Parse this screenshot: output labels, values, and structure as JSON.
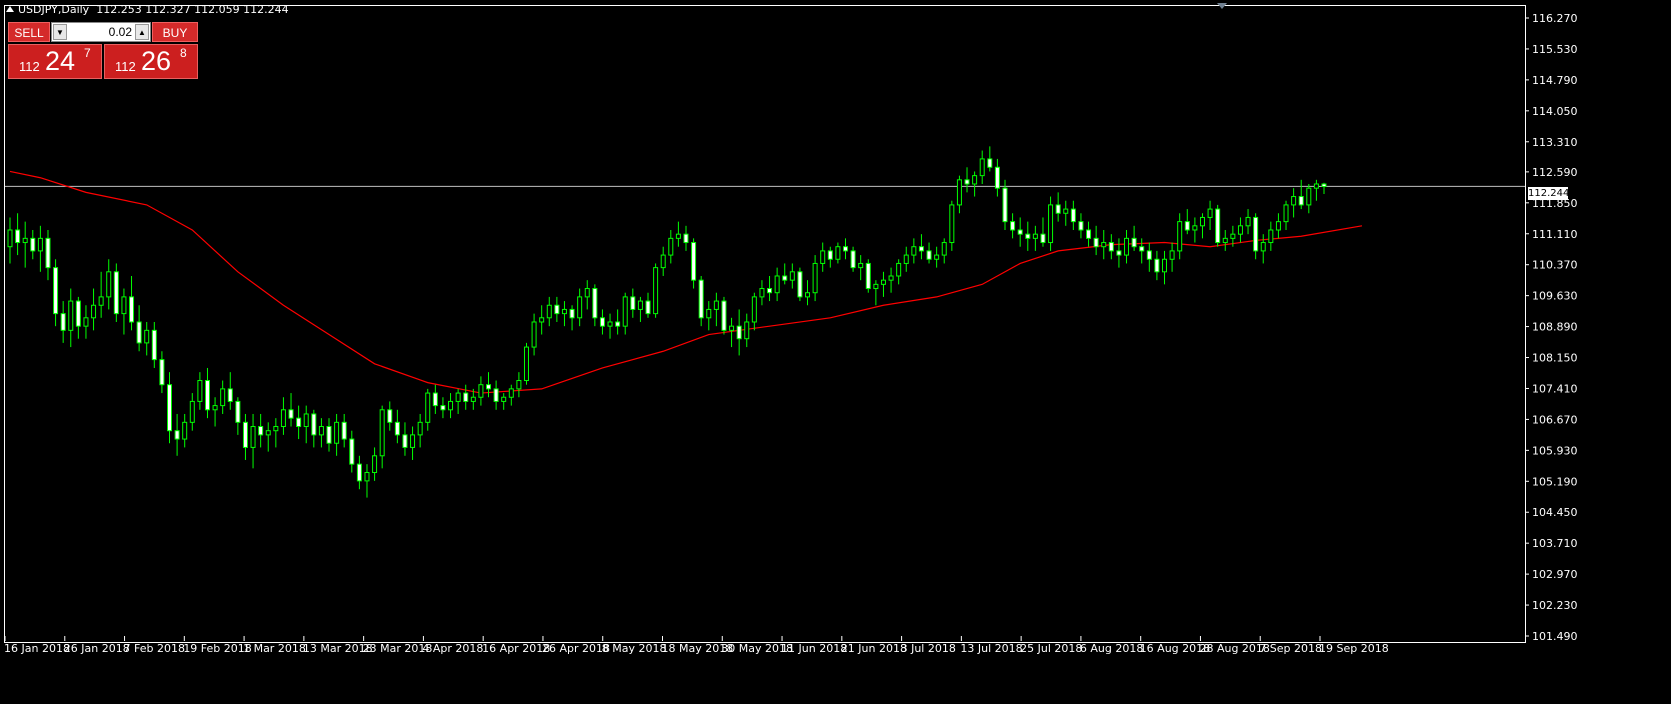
{
  "header": {
    "symbol": "USDJPY,Daily",
    "ohlc": "112.253 112.327 112.059 112.244"
  },
  "trade_panel": {
    "sell_label": "SELL",
    "buy_label": "BUY",
    "lot_value": "0.02",
    "bid": {
      "prefix": "112",
      "main": "24",
      "sup": "7"
    },
    "ask": {
      "prefix": "112",
      "main": "26",
      "sup": "8"
    }
  },
  "current_price_label": "112.244",
  "colors": {
    "bull": "#00ff00",
    "bear": "#00ff00",
    "ma": "#ff0000",
    "background": "#000000",
    "grid": "#ffffff",
    "current_line": "#c0c0c0"
  },
  "chart_data": {
    "type": "candlestick",
    "ylim": [
      101.49,
      116.27
    ],
    "y_ticks": [
      "116.270",
      "115.530",
      "114.790",
      "114.050",
      "113.310",
      "112.590",
      "111.850",
      "111.110",
      "110.370",
      "109.630",
      "108.890",
      "108.150",
      "107.410",
      "106.670",
      "105.930",
      "105.190",
      "104.450",
      "103.710",
      "102.970",
      "102.230",
      "101.490"
    ],
    "x_ticks": [
      "16 Jan 2018",
      "26 Jan 2018",
      "7 Feb 2018",
      "19 Feb 2018",
      "1 Mar 2018",
      "13 Mar 2018",
      "23 Mar 2018",
      "4 Apr 2018",
      "16 Apr 2018",
      "26 Apr 2018",
      "8 May 2018",
      "18 May 2018",
      "30 May 2018",
      "11 Jun 2018",
      "21 Jun 2018",
      "3 Jul 2018",
      "13 Jul 2018",
      "25 Jul 2018",
      "6 Aug 2018",
      "16 Aug 2018",
      "28 Aug 2018",
      "7 Sep 2018",
      "19 Sep 2018"
    ],
    "current_price": 112.244,
    "candles": [
      [
        110.8,
        111.5,
        110.4,
        111.2
      ],
      [
        111.2,
        111.6,
        110.6,
        110.9
      ],
      [
        110.9,
        111.4,
        110.3,
        111.0
      ],
      [
        111.0,
        111.2,
        110.5,
        110.7
      ],
      [
        110.7,
        111.3,
        110.2,
        111.0
      ],
      [
        111.0,
        111.2,
        110.0,
        110.3
      ],
      [
        110.3,
        110.5,
        108.9,
        109.2
      ],
      [
        109.2,
        109.5,
        108.5,
        108.8
      ],
      [
        108.8,
        109.8,
        108.4,
        109.5
      ],
      [
        109.5,
        109.6,
        108.6,
        108.9
      ],
      [
        108.9,
        109.4,
        108.6,
        109.1
      ],
      [
        109.1,
        109.8,
        108.8,
        109.4
      ],
      [
        109.4,
        110.2,
        109.1,
        109.6
      ],
      [
        109.6,
        110.5,
        109.3,
        110.2
      ],
      [
        110.2,
        110.4,
        109.0,
        109.2
      ],
      [
        109.2,
        109.8,
        108.7,
        109.6
      ],
      [
        109.6,
        110.1,
        108.8,
        109.0
      ],
      [
        109.0,
        109.4,
        108.3,
        108.5
      ],
      [
        108.5,
        109.0,
        108.2,
        108.8
      ],
      [
        108.8,
        109.0,
        107.9,
        108.1
      ],
      [
        108.1,
        108.3,
        107.3,
        107.5
      ],
      [
        107.5,
        107.8,
        106.1,
        106.4
      ],
      [
        106.4,
        106.8,
        105.8,
        106.2
      ],
      [
        106.2,
        106.8,
        106.0,
        106.6
      ],
      [
        106.6,
        107.3,
        106.4,
        107.1
      ],
      [
        107.1,
        107.8,
        106.9,
        107.6
      ],
      [
        107.6,
        107.9,
        106.7,
        106.9
      ],
      [
        106.9,
        107.2,
        106.5,
        107.0
      ],
      [
        107.0,
        107.6,
        106.8,
        107.4
      ],
      [
        107.4,
        107.8,
        106.9,
        107.1
      ],
      [
        107.1,
        107.2,
        106.3,
        106.6
      ],
      [
        106.6,
        106.8,
        105.7,
        106.0
      ],
      [
        106.0,
        106.8,
        105.5,
        106.5
      ],
      [
        106.5,
        106.8,
        106.0,
        106.3
      ],
      [
        106.3,
        106.6,
        105.9,
        106.4
      ],
      [
        106.4,
        106.7,
        106.0,
        106.5
      ],
      [
        106.5,
        107.2,
        106.3,
        106.9
      ],
      [
        106.9,
        107.3,
        106.5,
        106.7
      ],
      [
        106.7,
        107.0,
        106.2,
        106.5
      ],
      [
        106.5,
        107.0,
        106.1,
        106.8
      ],
      [
        106.8,
        106.9,
        106.0,
        106.3
      ],
      [
        106.3,
        106.7,
        106.0,
        106.5
      ],
      [
        106.5,
        106.7,
        105.9,
        106.1
      ],
      [
        106.1,
        106.8,
        105.8,
        106.6
      ],
      [
        106.6,
        106.8,
        106.0,
        106.2
      ],
      [
        106.2,
        106.4,
        105.4,
        105.6
      ],
      [
        105.6,
        105.8,
        105.0,
        105.2
      ],
      [
        105.2,
        105.6,
        104.8,
        105.4
      ],
      [
        105.4,
        106.0,
        105.2,
        105.8
      ],
      [
        105.8,
        107.0,
        105.5,
        106.9
      ],
      [
        106.9,
        107.1,
        106.4,
        106.6
      ],
      [
        106.6,
        106.9,
        106.1,
        106.3
      ],
      [
        106.3,
        106.6,
        105.8,
        106.0
      ],
      [
        106.0,
        106.5,
        105.7,
        106.3
      ],
      [
        106.3,
        106.8,
        106.0,
        106.6
      ],
      [
        106.6,
        107.4,
        106.4,
        107.3
      ],
      [
        107.3,
        107.5,
        106.8,
        107.0
      ],
      [
        107.0,
        107.2,
        106.7,
        106.9
      ],
      [
        106.9,
        107.3,
        106.7,
        107.1
      ],
      [
        107.1,
        107.4,
        106.8,
        107.3
      ],
      [
        107.3,
        107.5,
        106.9,
        107.1
      ],
      [
        107.1,
        107.4,
        106.9,
        107.2
      ],
      [
        107.2,
        107.7,
        107.0,
        107.5
      ],
      [
        107.5,
        107.8,
        107.2,
        107.4
      ],
      [
        107.4,
        107.6,
        106.9,
        107.1
      ],
      [
        107.1,
        107.3,
        106.9,
        107.2
      ],
      [
        107.2,
        107.5,
        107.0,
        107.4
      ],
      [
        107.4,
        107.8,
        107.2,
        107.6
      ],
      [
        107.6,
        108.5,
        107.5,
        108.4
      ],
      [
        108.4,
        109.2,
        108.2,
        109.0
      ],
      [
        109.0,
        109.4,
        108.7,
        109.1
      ],
      [
        109.1,
        109.6,
        108.9,
        109.4
      ],
      [
        109.4,
        109.6,
        109.0,
        109.2
      ],
      [
        109.2,
        109.5,
        108.9,
        109.3
      ],
      [
        109.3,
        109.4,
        108.8,
        109.1
      ],
      [
        109.1,
        109.8,
        108.9,
        109.6
      ],
      [
        109.6,
        110.0,
        109.3,
        109.8
      ],
      [
        109.8,
        109.9,
        108.9,
        109.1
      ],
      [
        109.1,
        109.3,
        108.7,
        108.9
      ],
      [
        108.9,
        109.2,
        108.6,
        109.0
      ],
      [
        109.0,
        109.3,
        108.7,
        108.9
      ],
      [
        108.9,
        109.7,
        108.7,
        109.6
      ],
      [
        109.6,
        109.8,
        109.1,
        109.3
      ],
      [
        109.3,
        109.6,
        109.0,
        109.5
      ],
      [
        109.5,
        109.7,
        109.1,
        109.2
      ],
      [
        109.2,
        110.4,
        109.1,
        110.3
      ],
      [
        110.3,
        110.8,
        110.1,
        110.6
      ],
      [
        110.6,
        111.2,
        110.4,
        111.0
      ],
      [
        111.0,
        111.4,
        110.8,
        111.1
      ],
      [
        111.1,
        111.3,
        110.7,
        110.9
      ],
      [
        110.9,
        111.0,
        109.8,
        110.0
      ],
      [
        110.0,
        110.1,
        108.9,
        109.1
      ],
      [
        109.1,
        109.5,
        108.8,
        109.3
      ],
      [
        109.3,
        109.7,
        108.9,
        109.5
      ],
      [
        109.5,
        109.6,
        108.7,
        108.8
      ],
      [
        108.8,
        109.1,
        108.4,
        108.9
      ],
      [
        108.9,
        109.3,
        108.2,
        108.6
      ],
      [
        108.6,
        109.2,
        108.4,
        109.0
      ],
      [
        109.0,
        109.7,
        108.8,
        109.6
      ],
      [
        109.6,
        110.0,
        109.4,
        109.8
      ],
      [
        109.8,
        110.1,
        109.5,
        109.7
      ],
      [
        109.7,
        110.3,
        109.5,
        110.1
      ],
      [
        110.1,
        110.4,
        109.9,
        110.0
      ],
      [
        110.0,
        110.4,
        109.8,
        110.2
      ],
      [
        110.2,
        110.3,
        109.5,
        109.6
      ],
      [
        109.6,
        110.0,
        109.4,
        109.7
      ],
      [
        109.7,
        110.6,
        109.5,
        110.4
      ],
      [
        110.4,
        110.9,
        110.2,
        110.7
      ],
      [
        110.7,
        110.8,
        110.3,
        110.5
      ],
      [
        110.5,
        110.9,
        110.4,
        110.8
      ],
      [
        110.8,
        111.0,
        110.5,
        110.7
      ],
      [
        110.7,
        110.8,
        110.2,
        110.3
      ],
      [
        110.3,
        110.6,
        110.0,
        110.4
      ],
      [
        110.4,
        110.5,
        109.7,
        109.8
      ],
      [
        109.8,
        110.0,
        109.4,
        109.9
      ],
      [
        109.9,
        110.2,
        109.6,
        110.0
      ],
      [
        110.0,
        110.3,
        109.7,
        110.1
      ],
      [
        110.1,
        110.5,
        109.9,
        110.4
      ],
      [
        110.4,
        110.8,
        110.2,
        110.6
      ],
      [
        110.6,
        111.0,
        110.4,
        110.8
      ],
      [
        110.8,
        111.1,
        110.5,
        110.7
      ],
      [
        110.7,
        110.9,
        110.4,
        110.5
      ],
      [
        110.5,
        110.8,
        110.3,
        110.6
      ],
      [
        110.6,
        111.0,
        110.4,
        110.9
      ],
      [
        110.9,
        111.9,
        110.7,
        111.8
      ],
      [
        111.8,
        112.5,
        111.6,
        112.4
      ],
      [
        112.4,
        112.7,
        112.1,
        112.3
      ],
      [
        112.3,
        112.6,
        112.0,
        112.5
      ],
      [
        112.5,
        113.1,
        112.3,
        112.9
      ],
      [
        112.9,
        113.2,
        112.6,
        112.7
      ],
      [
        112.7,
        112.9,
        112.0,
        112.2
      ],
      [
        112.2,
        112.4,
        111.2,
        111.4
      ],
      [
        111.4,
        111.6,
        111.0,
        111.2
      ],
      [
        111.2,
        111.5,
        110.8,
        111.1
      ],
      [
        111.1,
        111.4,
        110.7,
        111.0
      ],
      [
        111.0,
        111.3,
        110.7,
        111.1
      ],
      [
        111.1,
        111.5,
        110.8,
        110.9
      ],
      [
        110.9,
        112.0,
        110.7,
        111.8
      ],
      [
        111.8,
        112.1,
        111.4,
        111.6
      ],
      [
        111.6,
        111.9,
        111.3,
        111.7
      ],
      [
        111.7,
        111.9,
        111.2,
        111.4
      ],
      [
        111.4,
        111.6,
        111.0,
        111.2
      ],
      [
        111.2,
        111.4,
        110.8,
        111.0
      ],
      [
        111.0,
        111.3,
        110.6,
        110.8
      ],
      [
        110.8,
        111.2,
        110.5,
        110.9
      ],
      [
        110.9,
        111.1,
        110.5,
        110.7
      ],
      [
        110.7,
        111.0,
        110.3,
        110.6
      ],
      [
        110.6,
        111.2,
        110.4,
        111.0
      ],
      [
        111.0,
        111.3,
        110.7,
        110.8
      ],
      [
        110.8,
        111.0,
        110.4,
        110.7
      ],
      [
        110.7,
        110.9,
        110.2,
        110.5
      ],
      [
        110.5,
        110.7,
        110.0,
        110.2
      ],
      [
        110.2,
        110.7,
        109.9,
        110.5
      ],
      [
        110.5,
        110.9,
        110.2,
        110.7
      ],
      [
        110.7,
        111.6,
        110.5,
        111.4
      ],
      [
        111.4,
        111.7,
        111.1,
        111.2
      ],
      [
        111.2,
        111.5,
        110.9,
        111.3
      ],
      [
        111.3,
        111.6,
        111.0,
        111.5
      ],
      [
        111.5,
        111.9,
        111.2,
        111.7
      ],
      [
        111.7,
        111.8,
        110.8,
        110.9
      ],
      [
        110.9,
        111.2,
        110.7,
        111.0
      ],
      [
        111.0,
        111.3,
        110.8,
        111.1
      ],
      [
        111.1,
        111.5,
        110.9,
        111.3
      ],
      [
        111.3,
        111.7,
        111.1,
        111.5
      ],
      [
        111.5,
        111.6,
        110.5,
        110.7
      ],
      [
        110.7,
        111.1,
        110.4,
        110.9
      ],
      [
        110.9,
        111.4,
        110.7,
        111.2
      ],
      [
        111.2,
        111.6,
        111.0,
        111.4
      ],
      [
        111.4,
        111.9,
        111.2,
        111.8
      ],
      [
        111.8,
        112.2,
        111.5,
        112.0
      ],
      [
        112.0,
        112.4,
        111.7,
        111.8
      ],
      [
        111.8,
        112.3,
        111.6,
        112.2
      ],
      [
        112.2,
        112.4,
        111.9,
        112.3
      ],
      [
        112.3,
        112.33,
        112.06,
        112.24
      ]
    ],
    "moving_average": {
      "period_label": "",
      "points": [
        [
          0,
          112.6
        ],
        [
          4,
          112.45
        ],
        [
          10,
          112.1
        ],
        [
          18,
          111.8
        ],
        [
          24,
          111.2
        ],
        [
          30,
          110.2
        ],
        [
          36,
          109.4
        ],
        [
          42,
          108.7
        ],
        [
          48,
          108.0
        ],
        [
          55,
          107.55
        ],
        [
          62,
          107.3
        ],
        [
          70,
          107.4
        ],
        [
          78,
          107.9
        ],
        [
          86,
          108.3
        ],
        [
          92,
          108.7
        ],
        [
          100,
          108.9
        ],
        [
          108,
          109.1
        ],
        [
          115,
          109.4
        ],
        [
          122,
          109.6
        ],
        [
          128,
          109.9
        ],
        [
          133,
          110.4
        ],
        [
          138,
          110.7
        ],
        [
          145,
          110.85
        ],
        [
          152,
          110.9
        ],
        [
          158,
          110.8
        ],
        [
          164,
          110.95
        ],
        [
          170,
          111.05
        ],
        [
          178,
          111.3
        ]
      ]
    }
  }
}
